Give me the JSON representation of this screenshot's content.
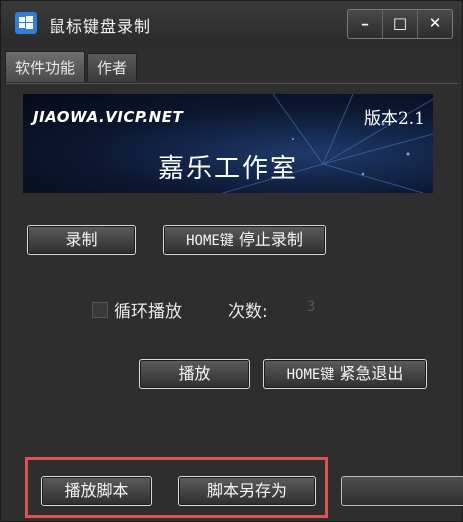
{
  "window": {
    "title": "鼠标键盘录制",
    "minimize_glyph": "━",
    "maximize_glyph": "□",
    "close_glyph": "✕"
  },
  "tabs": [
    {
      "label": "软件功能",
      "active": true
    },
    {
      "label": "作者",
      "active": false
    }
  ],
  "banner": {
    "site": "JIAOWA.VICP.NET",
    "version": "版本2.1",
    "studio": "嘉乐工作室"
  },
  "controls": {
    "record_label": "录制",
    "stop_hotkey": "HOME键",
    "stop_label": " 停止录制",
    "loop_label": "循环播放",
    "loop_checked": false,
    "count_label": "次数:",
    "count_value": "3",
    "play_label": "播放",
    "exit_hotkey": "HOME键",
    "exit_label": " 紧急退出"
  },
  "bottom": {
    "play_script_label": "播放脚本",
    "save_script_label": "脚本另存为"
  },
  "colors": {
    "highlight": "#d9534f",
    "app_icon": "#2f7fd6"
  }
}
